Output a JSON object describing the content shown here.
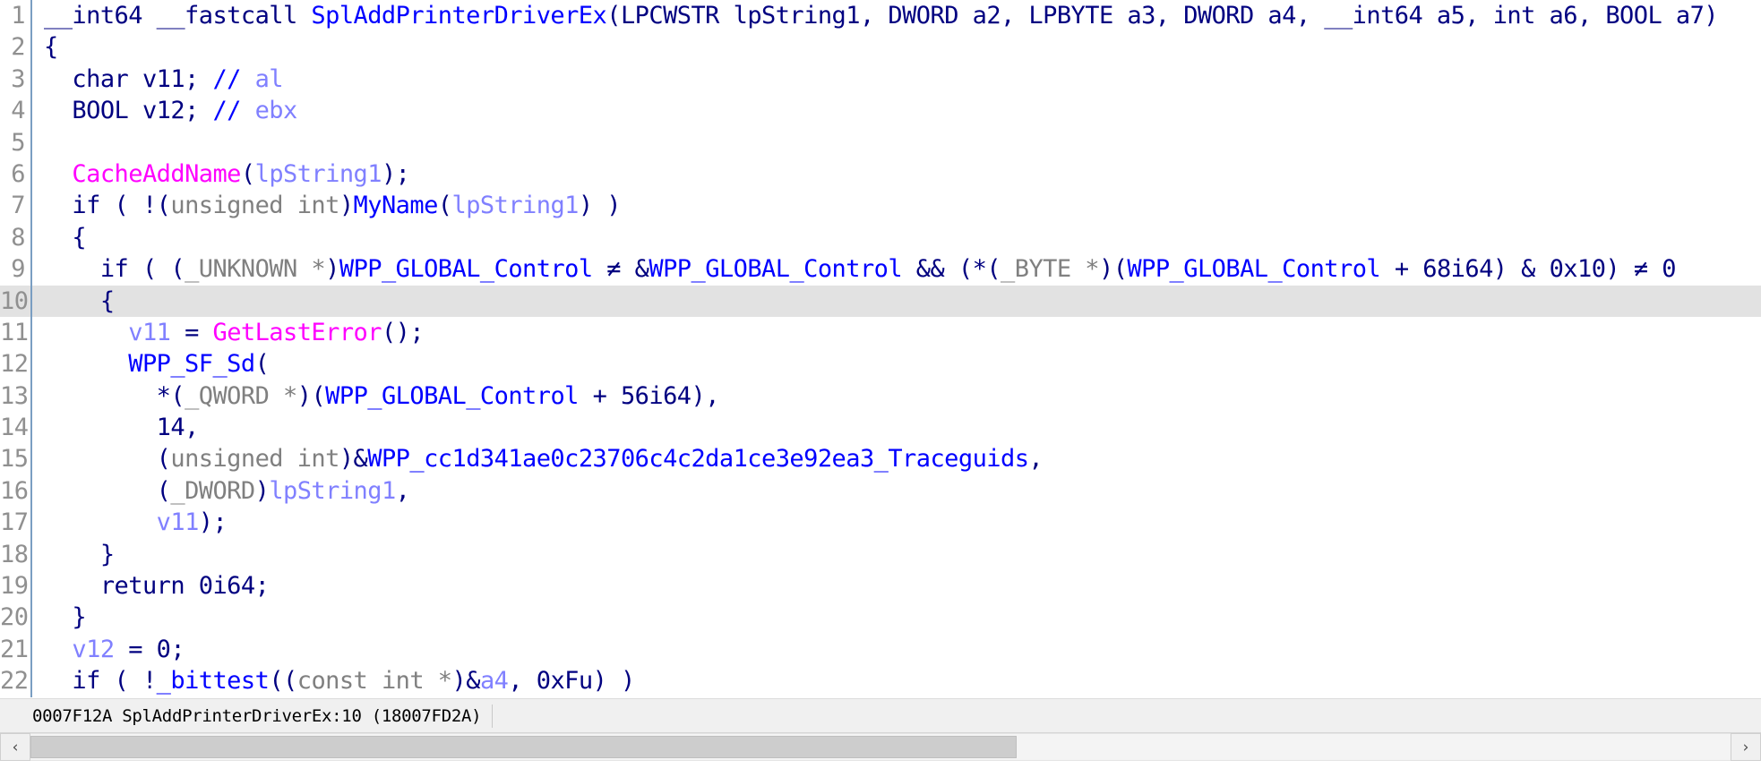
{
  "editor": {
    "kind": "hex-rays-pseudocode",
    "current_line": 10,
    "colors": {
      "background": "#ffffff",
      "line_number": "#909090",
      "gutter_rule": "#7a9ec2",
      "current_line_highlight": "#e2e2e2",
      "default_text": "#000080",
      "type_keyword": "#808080",
      "comment": "#8080ff",
      "comment_marker": "#0000ff",
      "function": "#0000ff",
      "library_function": "#ff00ff",
      "local_variable": "#8080ff",
      "global_symbol": "#0000ff",
      "status_bar_bg": "#f0f0f0"
    },
    "lines": [
      {
        "number": "1",
        "tokens": [
          {
            "t": "__int64 __fastcall ",
            "c": "t-default"
          },
          {
            "t": "SplAddPrinterDriverEx",
            "c": "t-func"
          },
          {
            "t": "(",
            "c": "t-punct"
          },
          {
            "t": "LPCWSTR ",
            "c": "t-default"
          },
          {
            "t": "lpString1",
            "c": "t-default"
          },
          {
            "t": ", DWORD a2, LPBYTE a3, DWORD a4, __int64 a5, int a6, BOOL a7)",
            "c": "t-default"
          }
        ]
      },
      {
        "number": "2",
        "tokens": [
          {
            "t": "{",
            "c": "t-punct"
          }
        ]
      },
      {
        "number": "3",
        "tokens": [
          {
            "t": "  char v11; ",
            "c": "t-default"
          },
          {
            "t": "//",
            "c": "t-commark"
          },
          {
            "t": " al",
            "c": "t-comment"
          }
        ]
      },
      {
        "number": "4",
        "tokens": [
          {
            "t": "  BOOL v12; ",
            "c": "t-default"
          },
          {
            "t": "//",
            "c": "t-commark"
          },
          {
            "t": " ebx",
            "c": "t-comment"
          }
        ]
      },
      {
        "number": "5",
        "tokens": [
          {
            "t": "",
            "c": "t-default"
          }
        ]
      },
      {
        "number": "6",
        "tokens": [
          {
            "t": "  ",
            "c": "t-default"
          },
          {
            "t": "CacheAddName",
            "c": "t-libfunc"
          },
          {
            "t": "(",
            "c": "t-punct"
          },
          {
            "t": "lpString1",
            "c": "t-var"
          },
          {
            "t": ");",
            "c": "t-punct"
          }
        ]
      },
      {
        "number": "7",
        "tokens": [
          {
            "t": "  if ( !(",
            "c": "t-default"
          },
          {
            "t": "unsigned int",
            "c": "t-type"
          },
          {
            "t": ")",
            "c": "t-punct"
          },
          {
            "t": "MyName",
            "c": "t-func"
          },
          {
            "t": "(",
            "c": "t-punct"
          },
          {
            "t": "lpString1",
            "c": "t-var"
          },
          {
            "t": ") )",
            "c": "t-punct"
          }
        ]
      },
      {
        "number": "8",
        "tokens": [
          {
            "t": "  {",
            "c": "t-punct"
          }
        ]
      },
      {
        "number": "9",
        "tokens": [
          {
            "t": "    if ( (",
            "c": "t-default"
          },
          {
            "t": "_UNKNOWN ",
            "c": "t-type"
          },
          {
            "t": "*",
            "c": "t-type"
          },
          {
            "t": ")",
            "c": "t-punct"
          },
          {
            "t": "WPP_GLOBAL_Control",
            "c": "t-global"
          },
          {
            "t": " ≠ &",
            "c": "t-default"
          },
          {
            "t": "WPP_GLOBAL_Control",
            "c": "t-global"
          },
          {
            "t": " && (*(",
            "c": "t-default"
          },
          {
            "t": "_BYTE ",
            "c": "t-type"
          },
          {
            "t": "*",
            "c": "t-type"
          },
          {
            "t": ")(",
            "c": "t-punct"
          },
          {
            "t": "WPP_GLOBAL_Control",
            "c": "t-global"
          },
          {
            "t": " + 68i64) & 0x10) ≠ 0",
            "c": "t-default"
          }
        ]
      },
      {
        "number": "10",
        "tokens": [
          {
            "t": "    {",
            "c": "t-punct"
          }
        ]
      },
      {
        "number": "11",
        "tokens": [
          {
            "t": "      ",
            "c": "t-default"
          },
          {
            "t": "v11",
            "c": "t-var"
          },
          {
            "t": " = ",
            "c": "t-default"
          },
          {
            "t": "GetLastError",
            "c": "t-libfunc"
          },
          {
            "t": "();",
            "c": "t-punct"
          }
        ]
      },
      {
        "number": "12",
        "tokens": [
          {
            "t": "      ",
            "c": "t-default"
          },
          {
            "t": "WPP_SF_Sd",
            "c": "t-func"
          },
          {
            "t": "(",
            "c": "t-punct"
          }
        ]
      },
      {
        "number": "13",
        "tokens": [
          {
            "t": "        *(",
            "c": "t-default"
          },
          {
            "t": "_QWORD ",
            "c": "t-type"
          },
          {
            "t": "*",
            "c": "t-type"
          },
          {
            "t": ")(",
            "c": "t-punct"
          },
          {
            "t": "WPP_GLOBAL_Control",
            "c": "t-global"
          },
          {
            "t": " + 56i64),",
            "c": "t-default"
          }
        ]
      },
      {
        "number": "14",
        "tokens": [
          {
            "t": "        14,",
            "c": "t-default"
          }
        ]
      },
      {
        "number": "15",
        "tokens": [
          {
            "t": "        (",
            "c": "t-punct"
          },
          {
            "t": "unsigned int",
            "c": "t-type"
          },
          {
            "t": ")&",
            "c": "t-punct"
          },
          {
            "t": "WPP_cc1d341ae0c23706c4c2da1ce3e92ea3_Traceguids",
            "c": "t-global"
          },
          {
            "t": ",",
            "c": "t-punct"
          }
        ]
      },
      {
        "number": "16",
        "tokens": [
          {
            "t": "        (",
            "c": "t-punct"
          },
          {
            "t": "_DWORD",
            "c": "t-type"
          },
          {
            "t": ")",
            "c": "t-punct"
          },
          {
            "t": "lpString1",
            "c": "t-var"
          },
          {
            "t": ",",
            "c": "t-punct"
          }
        ]
      },
      {
        "number": "17",
        "tokens": [
          {
            "t": "        ",
            "c": "t-default"
          },
          {
            "t": "v11",
            "c": "t-var"
          },
          {
            "t": ");",
            "c": "t-punct"
          }
        ]
      },
      {
        "number": "18",
        "tokens": [
          {
            "t": "    }",
            "c": "t-punct"
          }
        ]
      },
      {
        "number": "19",
        "tokens": [
          {
            "t": "    return 0i64;",
            "c": "t-default"
          }
        ]
      },
      {
        "number": "20",
        "tokens": [
          {
            "t": "  }",
            "c": "t-punct"
          }
        ]
      },
      {
        "number": "21",
        "tokens": [
          {
            "t": "  ",
            "c": "t-default"
          },
          {
            "t": "v12",
            "c": "t-var"
          },
          {
            "t": " = 0;",
            "c": "t-default"
          }
        ]
      },
      {
        "number": "22",
        "tokens": [
          {
            "t": "  if ( !",
            "c": "t-default"
          },
          {
            "t": "_bittest",
            "c": "t-func"
          },
          {
            "t": "((",
            "c": "t-punct"
          },
          {
            "t": "const int ",
            "c": "t-type"
          },
          {
            "t": "*",
            "c": "t-type"
          },
          {
            "t": ")&",
            "c": "t-punct"
          },
          {
            "t": "a4",
            "c": "t-var"
          },
          {
            "t": ", 0xFu) )",
            "c": "t-default"
          }
        ]
      }
    ]
  },
  "status_bar": {
    "address": "0007F12A",
    "location": "SplAddPrinterDriverEx:10",
    "virtual_address": "(18007FD2A)",
    "full_text": "0007F12A SplAddPrinterDriverEx:10 (18007FD2A)"
  },
  "scrollbar": {
    "left_arrow": "‹",
    "right_arrow": "›",
    "thumb_position_percent": 0,
    "thumb_width_percent": 58
  }
}
